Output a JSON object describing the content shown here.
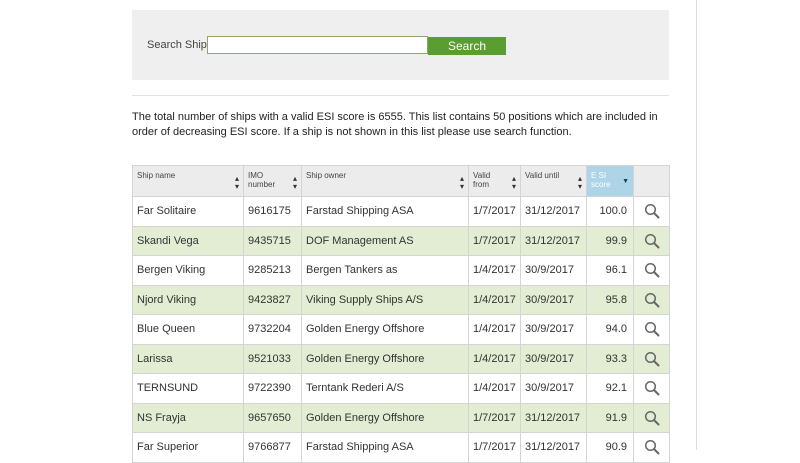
{
  "search": {
    "label": "Search Ship:",
    "value": "",
    "placeholder": "",
    "button_label": "Search"
  },
  "intro_text": "The total number of ships with a valid ESI score is 6555. This list contains 50 positions which are included in order of decreasing ESI score. If a ship is not shown in this list please use search function.",
  "table": {
    "headers": {
      "ship_name": "Ship name",
      "imo_line1": "IMO",
      "imo_line2": "number",
      "owner": "Ship owner",
      "valid_from_line1": "Valid",
      "valid_from_line2": "from",
      "valid_until": "Valid until",
      "esi_line1": "E SI",
      "esi_line2": "score"
    },
    "rows": [
      {
        "name": "Far Solitaire",
        "imo": "9616175",
        "owner": "Farstad Shipping ASA",
        "from": "1/7/2017",
        "until": "31/12/2017",
        "score": "100.0"
      },
      {
        "name": "Skandi Vega",
        "imo": "9435715",
        "owner": "DOF Management AS",
        "from": "1/7/2017",
        "until": "31/12/2017",
        "score": "99.9"
      },
      {
        "name": "Bergen Viking",
        "imo": "9285213",
        "owner": "Bergen Tankers as",
        "from": "1/4/2017",
        "until": "30/9/2017",
        "score": "96.1"
      },
      {
        "name": "Njord Viking",
        "imo": "9423827",
        "owner": "Viking Supply Ships A/S",
        "from": "1/4/2017",
        "until": "30/9/2017",
        "score": "95.8"
      },
      {
        "name": "Blue Queen",
        "imo": "9732204",
        "owner": "Golden Energy Offshore",
        "from": "1/4/2017",
        "until": "30/9/2017",
        "score": "94.0"
      },
      {
        "name": "Larissa",
        "imo": "9521033",
        "owner": "Golden Energy Offshore",
        "from": "1/4/2017",
        "until": "30/9/2017",
        "score": "93.3"
      },
      {
        "name": "TERNSUND",
        "imo": "9722390",
        "owner": "Terntank Rederi A/S",
        "from": "1/4/2017",
        "until": "30/9/2017",
        "score": "92.1"
      },
      {
        "name": "NS Frayja",
        "imo": "9657650",
        "owner": "Golden Energy Offshore",
        "from": "1/7/2017",
        "until": "31/12/2017",
        "score": "91.9"
      },
      {
        "name": "Far Superior",
        "imo": "9766877",
        "owner": "Farstad Shipping ASA",
        "from": "1/7/2017",
        "until": "31/12/2017",
        "score": "90.9"
      }
    ]
  },
  "colors": {
    "button_green": "#5a9e32",
    "row_alt_green": "#e2edd3",
    "active_header_blue": "#aed4e8"
  },
  "icons": {
    "sort": "sort-arrows-icon",
    "sort_desc": "sort-desc-icon",
    "details": "magnifier-icon"
  }
}
